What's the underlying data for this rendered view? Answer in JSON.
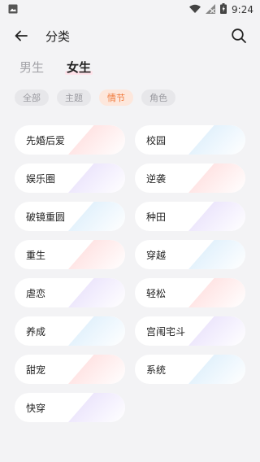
{
  "status_bar": {
    "time": "9:24"
  },
  "app_bar": {
    "title": "分类",
    "back_icon": "back-arrow-icon",
    "search_icon": "search-icon"
  },
  "gender_tabs": [
    {
      "label": "男生",
      "active": false
    },
    {
      "label": "女生",
      "active": true
    }
  ],
  "filter_chips": [
    {
      "label": "全部",
      "active": false
    },
    {
      "label": "主题",
      "active": false
    },
    {
      "label": "情节",
      "active": true
    },
    {
      "label": "角色",
      "active": false
    }
  ],
  "categories": [
    {
      "label": "先婚后爱",
      "tint": "#ffd9d9"
    },
    {
      "label": "校园",
      "tint": "#d7ecfb"
    },
    {
      "label": "娱乐圈",
      "tint": "#e5dcfb"
    },
    {
      "label": "逆袭",
      "tint": "#ffd9d9"
    },
    {
      "label": "破镜重圆",
      "tint": "#d7ecfb"
    },
    {
      "label": "种田",
      "tint": "#e5dcfb"
    },
    {
      "label": "重生",
      "tint": "#ffd9d9"
    },
    {
      "label": "穿越",
      "tint": "#d7ecfb"
    },
    {
      "label": "虐恋",
      "tint": "#e5dcfb"
    },
    {
      "label": "轻松",
      "tint": "#ffd9d9"
    },
    {
      "label": "养成",
      "tint": "#d7ecfb"
    },
    {
      "label": "宫闱宅斗",
      "tint": "#e5dcfb"
    },
    {
      "label": "甜宠",
      "tint": "#ffd9d9"
    },
    {
      "label": "系统",
      "tint": "#d7ecfb"
    },
    {
      "label": "快穿",
      "tint": "#e5dcfb"
    }
  ]
}
